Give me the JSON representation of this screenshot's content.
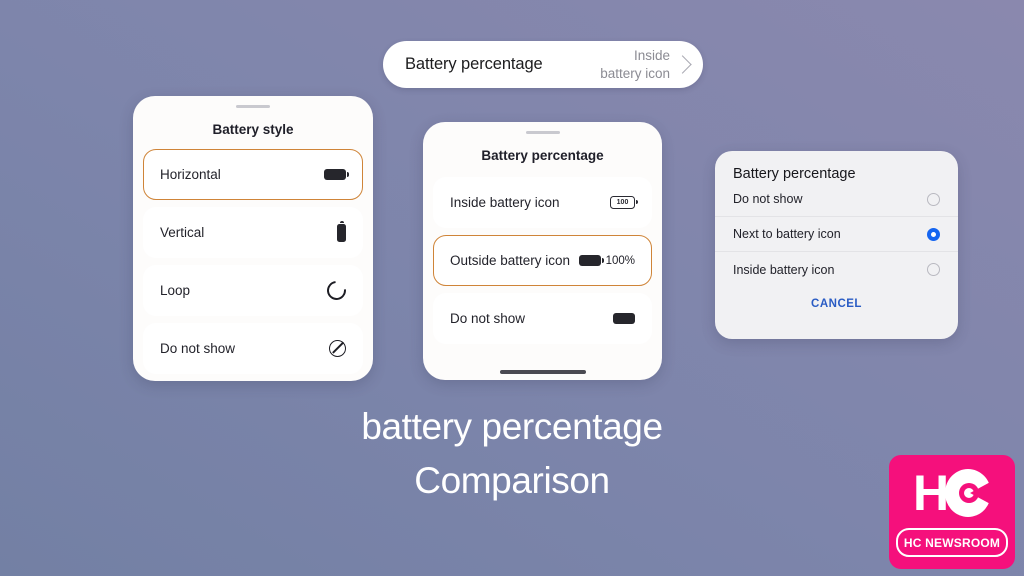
{
  "background": {
    "gradient_from": "#7380a4",
    "gradient_to": "#8a88ae"
  },
  "top_pill": {
    "title": "Battery percentage",
    "value_line1": "Inside",
    "value_line2": "battery icon",
    "chevron": "chevron-right-icon"
  },
  "left_sheet": {
    "title": "Battery style",
    "highlight_color": "#cf8438",
    "options": [
      {
        "label": "Horizontal",
        "icon": "battery-horizontal-icon",
        "selected": true
      },
      {
        "label": "Vertical",
        "icon": "battery-vertical-icon",
        "selected": false
      },
      {
        "label": "Loop",
        "icon": "battery-loop-icon",
        "selected": false
      },
      {
        "label": "Do not show",
        "icon": "no-entry-icon",
        "selected": false
      }
    ]
  },
  "middle_sheet": {
    "title": "Battery percentage",
    "highlight_color": "#cf8438",
    "options": [
      {
        "label": "Inside battery icon",
        "icon": "battery-with-number-icon",
        "icon_text": "100",
        "sub": "",
        "selected": false
      },
      {
        "label": "Outside battery icon",
        "icon": "battery-filled-icon",
        "icon_text": "",
        "sub": "100%",
        "selected": true
      },
      {
        "label": "Do not show",
        "icon": "battery-segments-icon",
        "icon_text": "",
        "sub": "",
        "selected": false
      }
    ]
  },
  "right_dialog": {
    "title": "Battery percentage",
    "accent_color": "#1565f0",
    "options": [
      {
        "label": "Do not show",
        "selected": false
      },
      {
        "label": "Next to battery icon",
        "selected": true
      },
      {
        "label": "Inside battery icon",
        "selected": false
      }
    ],
    "cancel_label": "CANCEL"
  },
  "caption": {
    "line1": "battery percentage",
    "line2": "Comparison"
  },
  "logo": {
    "brand_mark": "HC",
    "brand_name": "HC NEWSROOM",
    "color": "#f5107c"
  }
}
